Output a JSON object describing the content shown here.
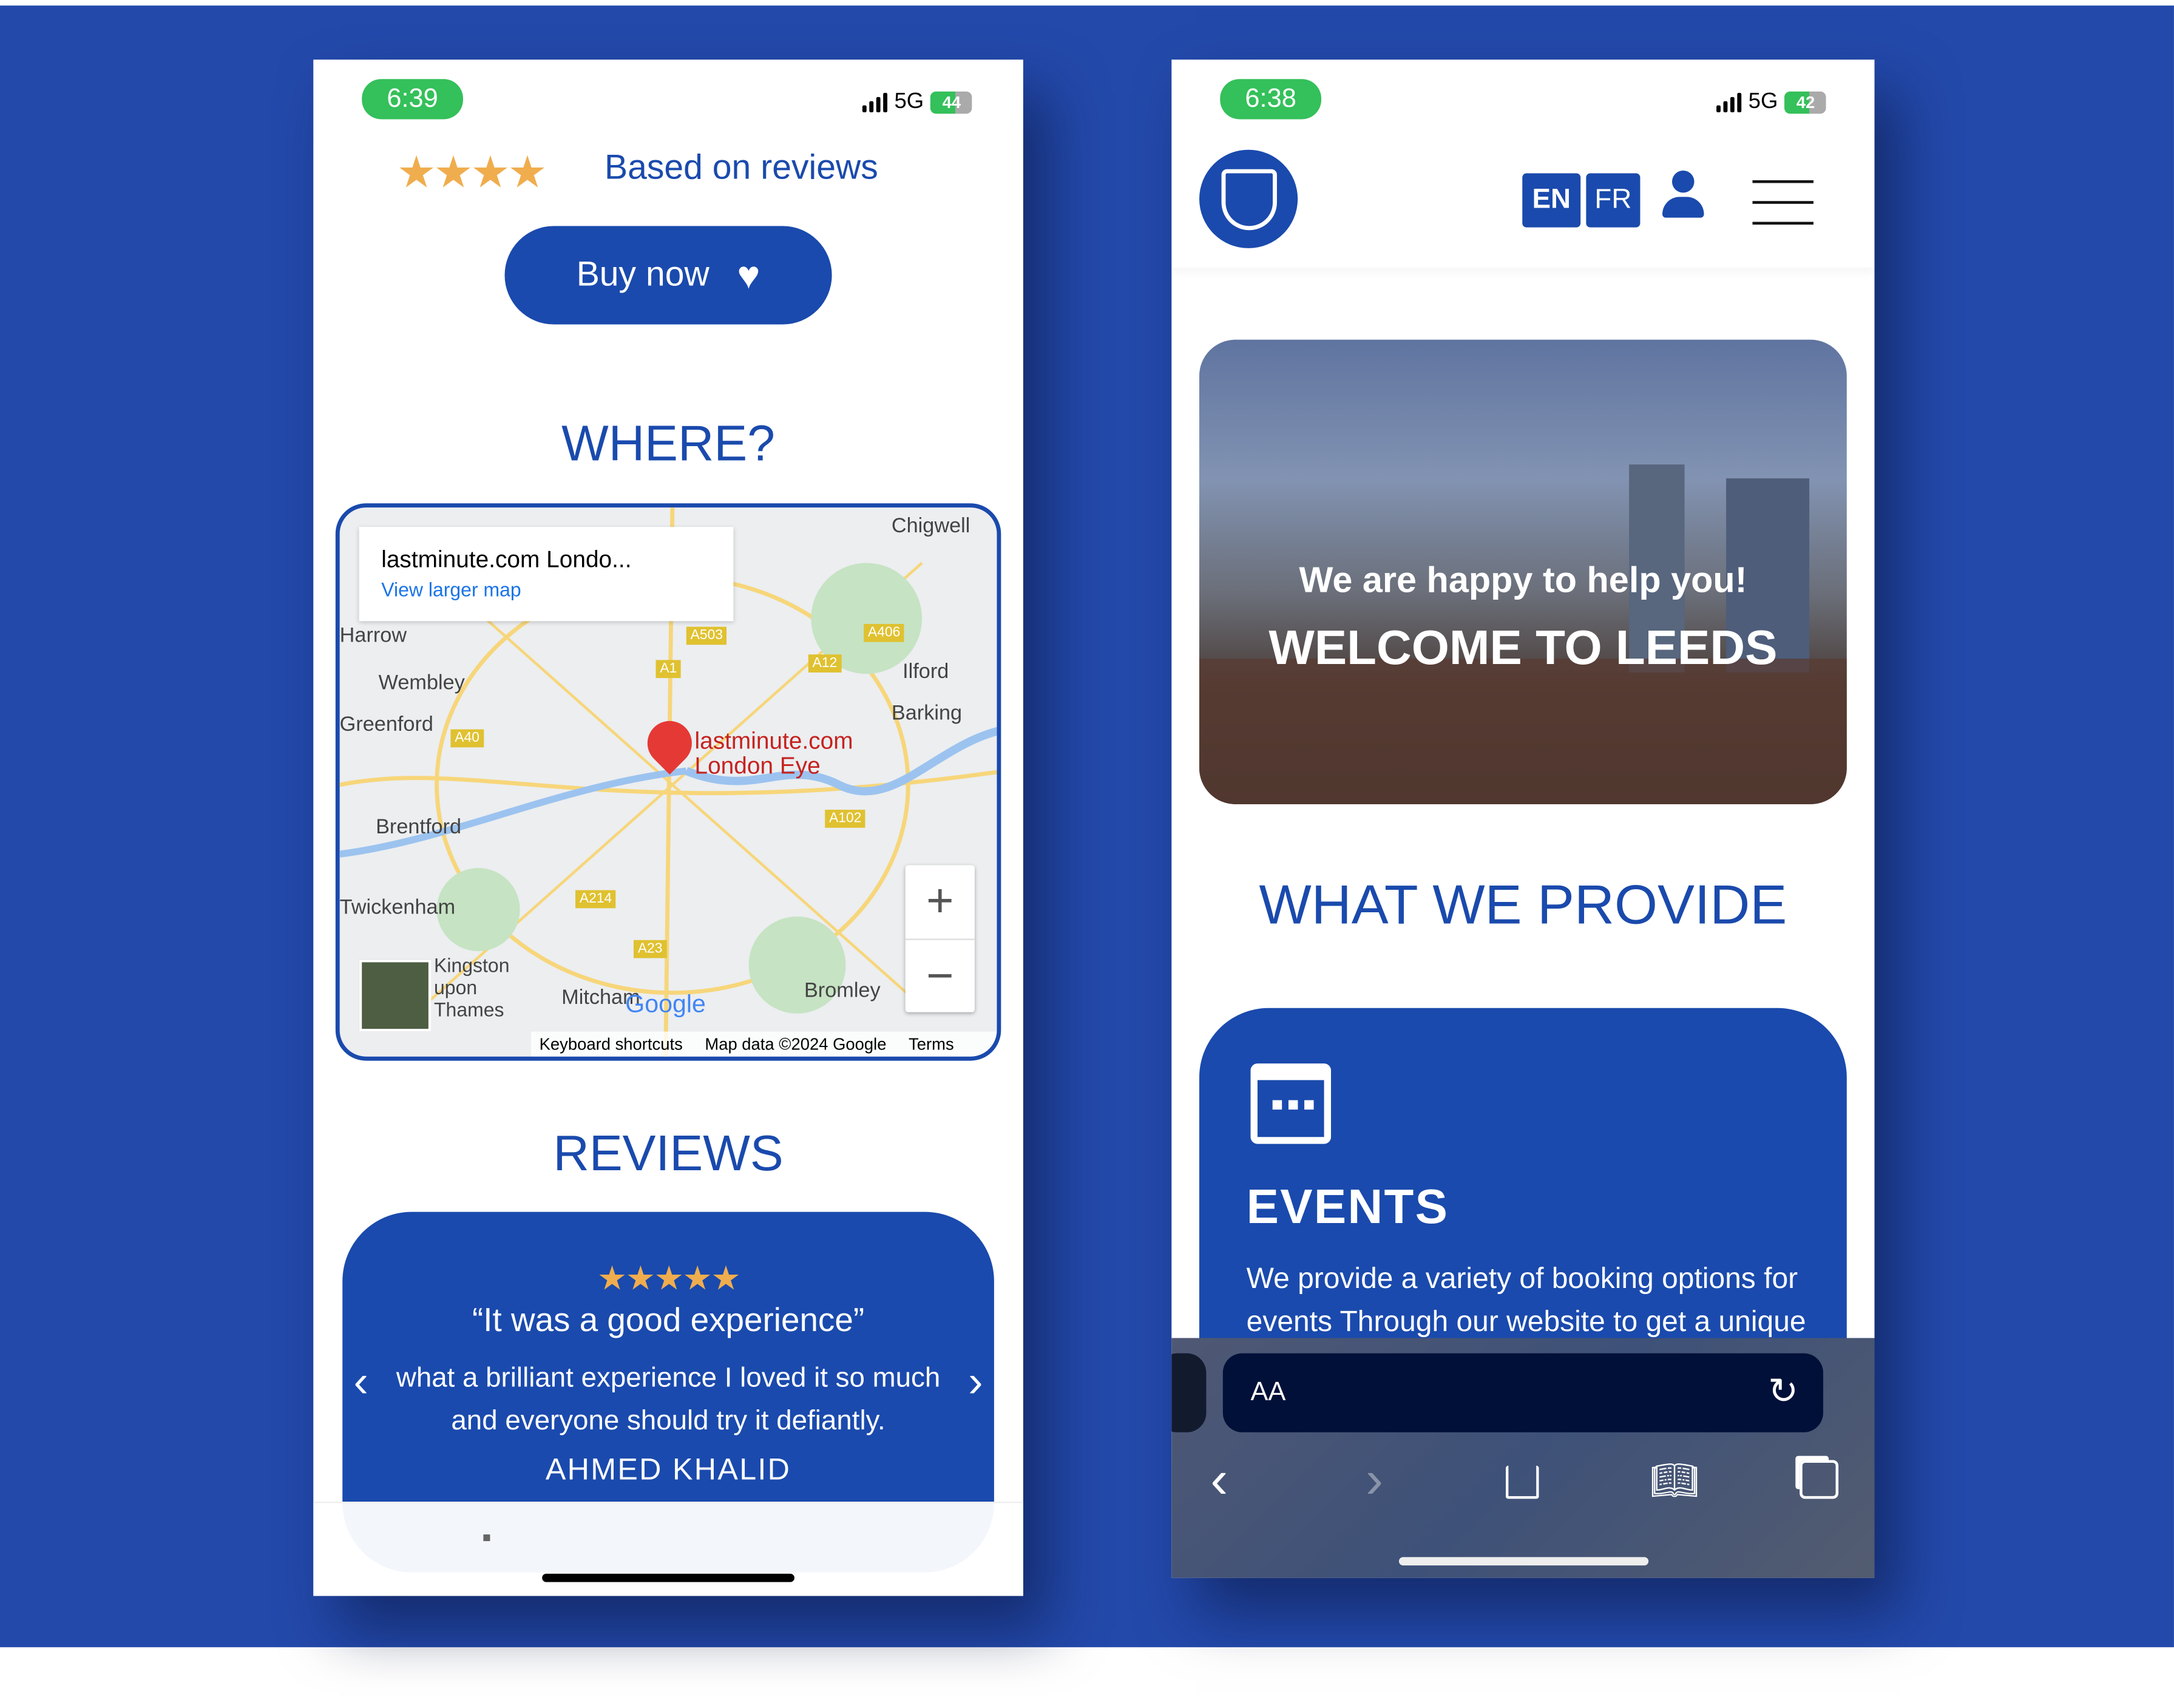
{
  "colors": {
    "brand": "#1a4aad",
    "star": "#f0ad4e",
    "status_green": "#34c05a",
    "background": "#2349ab"
  },
  "left_phone": {
    "status": {
      "time": "6:39",
      "network": "5G",
      "battery": "44"
    },
    "rating": {
      "stars": 4,
      "label": "Based on reviews"
    },
    "buy_button": {
      "label": "Buy now",
      "icon": "heart-icon"
    },
    "where_title": "WHERE?",
    "map": {
      "place_title": "lastminute.com Londo...",
      "view_larger": "View larger map",
      "pin_label_1": "lastminute.com",
      "pin_label_2": "London Eye",
      "labels": [
        "Chigwell",
        "Harrow",
        "Wembley",
        "Ilford",
        "Barking",
        "Greenford",
        "Brentford",
        "Twickenham",
        "Kingston upon Thames",
        "Mitcham",
        "Bromley"
      ],
      "roads": [
        "A503",
        "A406",
        "A1",
        "A12",
        "A40",
        "A102",
        "A214",
        "A23"
      ],
      "zoom_in": "+",
      "zoom_out": "−",
      "attribution": "Google",
      "footer": {
        "shortcuts": "Keyboard shortcuts",
        "data": "Map data ©2024 Google",
        "terms": "Terms"
      }
    },
    "reviews_title": "REVIEWS",
    "review": {
      "stars": 5,
      "quote": "“It was a good experience”",
      "text": "what a brilliant experience I loved it so much and everyone should try it defiantly.",
      "author": "AHMED KHALID"
    }
  },
  "right_phone": {
    "status": {
      "time": "6:38",
      "network": "5G",
      "battery": "42"
    },
    "lang": [
      "EN",
      "FR"
    ],
    "hero": {
      "subtitle": "We are happy to help you!",
      "title": "WELCOME TO LEEDS"
    },
    "provide_title": "WHAT WE PROVIDE",
    "card": {
      "icon": "calendar-icon",
      "title": "EVENTS",
      "text": "We provide a variety of booking options for events Through our website to get a unique"
    },
    "browser": {
      "aa": "AA"
    }
  }
}
